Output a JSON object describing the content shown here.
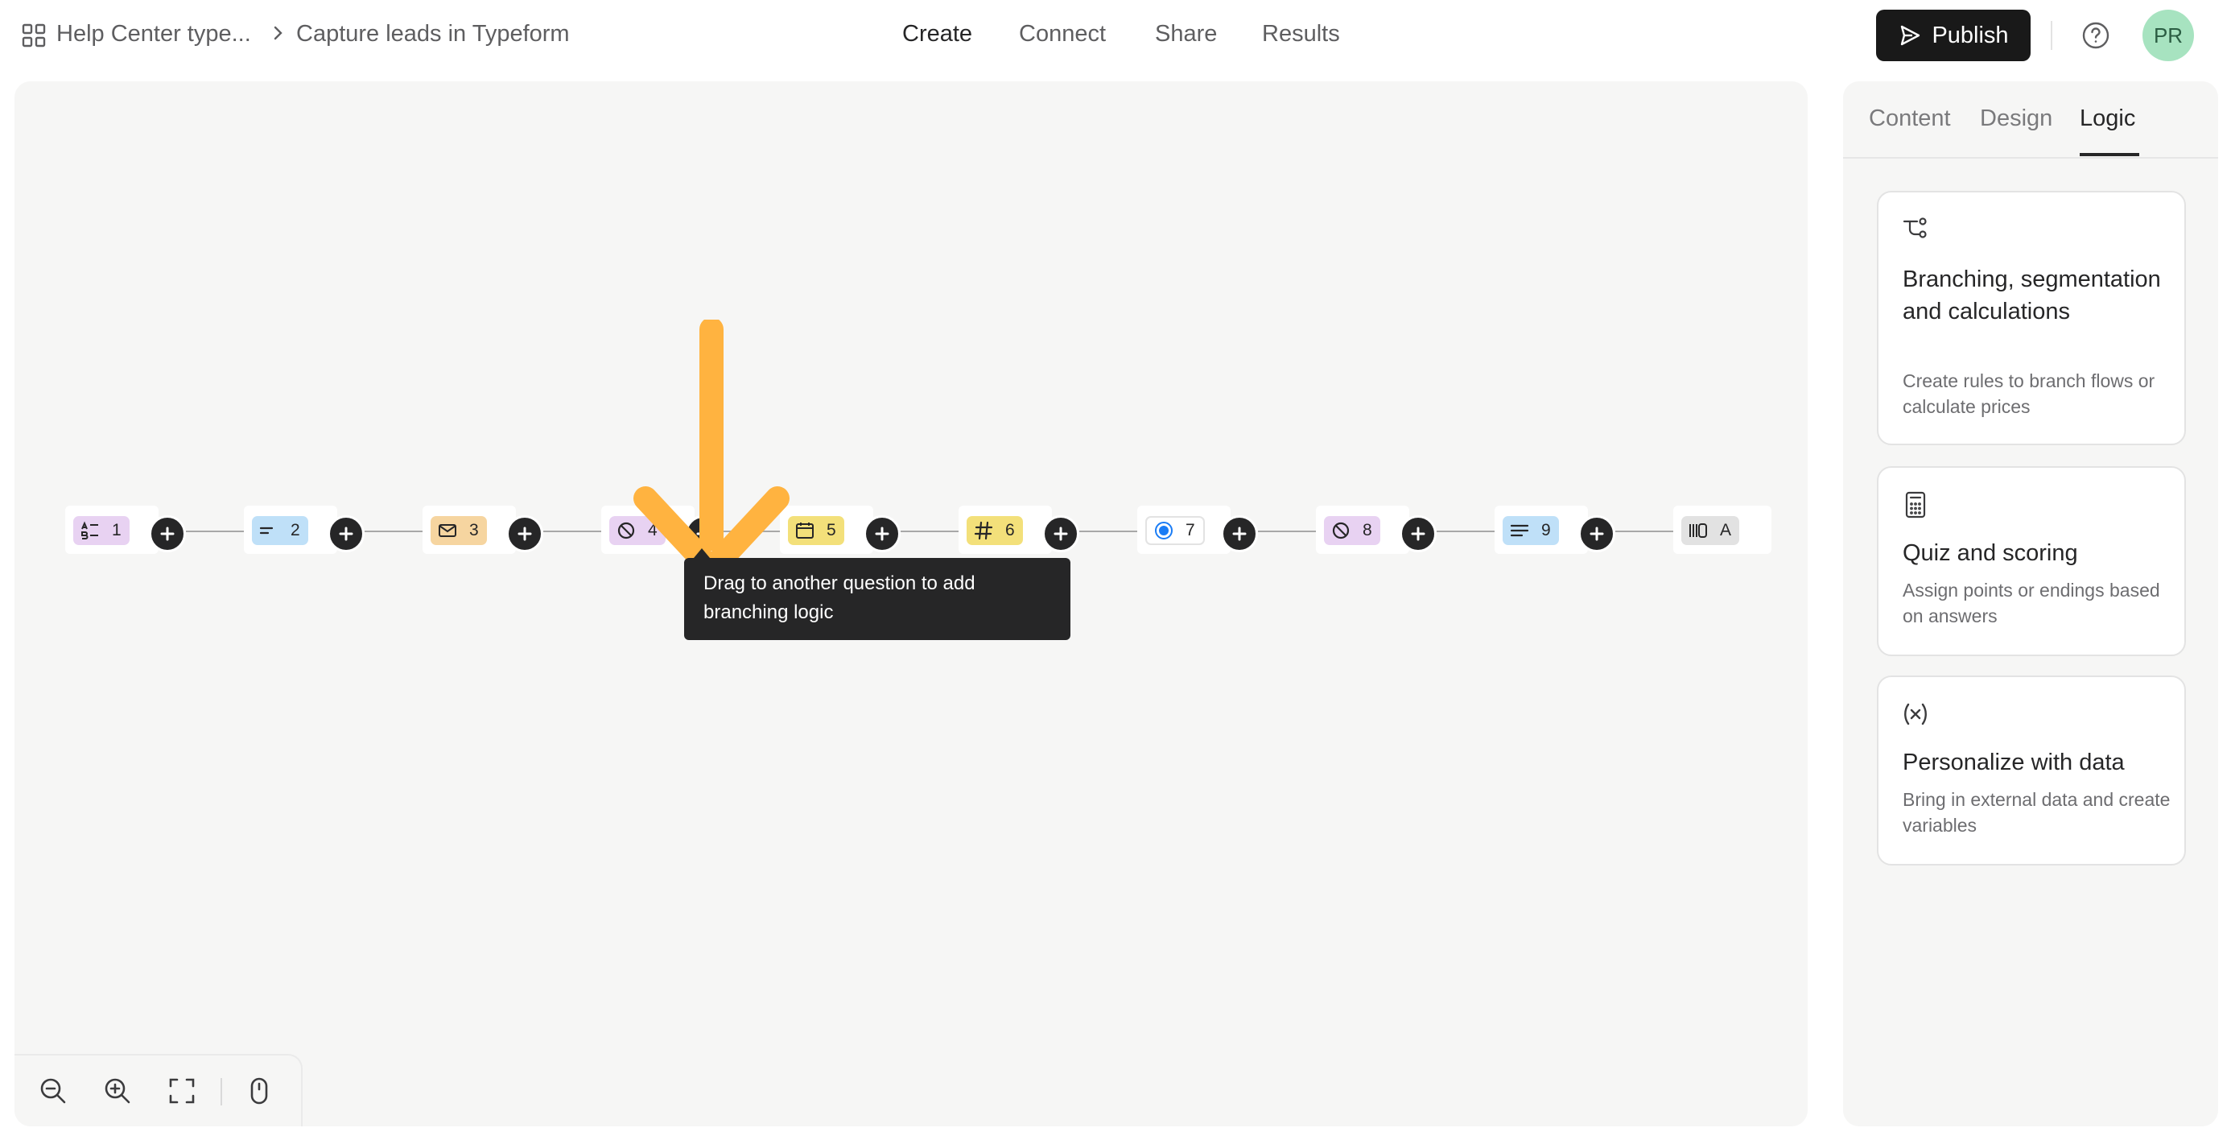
{
  "header": {
    "breadcrumb_root": "Help Center type...",
    "breadcrumb_current": "Capture leads in Typeform",
    "nav": [
      "Create",
      "Connect",
      "Share",
      "Results"
    ],
    "active_nav": "Create",
    "publish_label": "Publish",
    "avatar_initials": "PR"
  },
  "flow": {
    "nodes": [
      {
        "label": "1",
        "icon": "multiple-choice-icon",
        "color": "#e8d2f2"
      },
      {
        "label": "2",
        "icon": "short-text-icon",
        "color": "#bfe0f8"
      },
      {
        "label": "3",
        "icon": "email-icon",
        "color": "#f6d5a0"
      },
      {
        "label": "4",
        "icon": "no-symbol-icon",
        "color": "#e8d2f2"
      },
      {
        "label": "5",
        "icon": "calendar-icon",
        "color": "#f3e07a"
      },
      {
        "label": "6",
        "icon": "number-icon",
        "color": "#f3e07a"
      },
      {
        "label": "7",
        "icon": "radio-icon",
        "color": "#ffffff"
      },
      {
        "label": "8",
        "icon": "no-symbol-icon",
        "color": "#e8d2f2"
      },
      {
        "label": "9",
        "icon": "long-text-icon",
        "color": "#bfe0f8"
      },
      {
        "label": "A",
        "icon": "ending-icon",
        "color": "#e2e2e2"
      }
    ],
    "tooltip": "Drag to another question to add branching logic",
    "highlight_color": "#ffb340"
  },
  "panel": {
    "tabs": [
      "Content",
      "Design",
      "Logic"
    ],
    "active_tab": "Logic",
    "cards": [
      {
        "icon": "branching-icon",
        "title": "Branching, segmentation and calculations",
        "desc": "Create rules to branch flows or calculate prices"
      },
      {
        "icon": "calculator-icon",
        "title": "Quiz and scoring",
        "desc": "Assign points or endings based on answers"
      },
      {
        "icon": "variable-icon",
        "title": "Personalize with data",
        "desc": "Bring in external data and create variables"
      }
    ]
  }
}
